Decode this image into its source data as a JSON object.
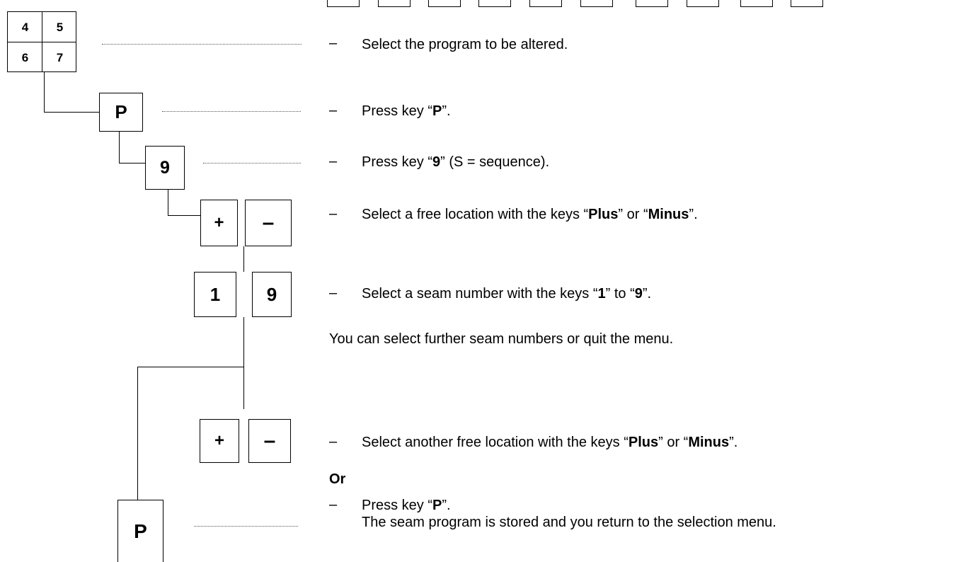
{
  "keypad": {
    "k4": "4",
    "k5": "5",
    "k6": "6",
    "k7": "7"
  },
  "keys": {
    "p": "P",
    "nine": "9",
    "plus": "+",
    "minus": "–",
    "one": "1"
  },
  "steps": {
    "dash": "–",
    "select_program": "Select the program to be altered.",
    "press_p_pre": "Press key “",
    "press_p_key": "P",
    "press_p_post": "”.",
    "press_9_pre": "Press key “",
    "press_9_key": "9",
    "press_9_post": "” (S = sequence).",
    "free_loc_pre": "Select a free location with the keys “",
    "free_loc_plus": "Plus",
    "free_loc_mid": "” or “",
    "free_loc_minus": "Minus",
    "free_loc_post": "”.",
    "seam_pre": "Select a seam number with the keys “",
    "seam_one": "1",
    "seam_mid": "” to “",
    "seam_nine": "9",
    "seam_post": "”.",
    "further": "You can select further seam numbers or quit the menu.",
    "another_pre": "Select another free location with the keys “",
    "another_plus": "Plus",
    "another_mid": "” or “",
    "another_minus": "Minus",
    "another_post": "”.",
    "or": "Or",
    "final_pre": "Press key “",
    "final_key": "P",
    "final_post": "”.",
    "stored": "The seam program is stored and you return to the selection menu."
  }
}
